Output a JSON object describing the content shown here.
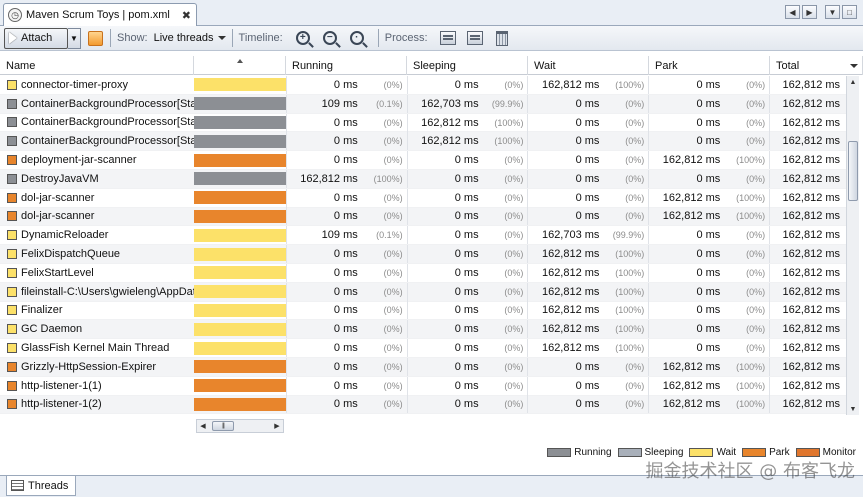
{
  "window": {
    "tab_title": "Maven Scrum Toys | pom.xml",
    "tab_close": "✖"
  },
  "toolbar": {
    "attach_label": "Attach",
    "show_label": "Show:",
    "show_value": "Live threads",
    "timeline_label": "Timeline:",
    "process_label": "Process:"
  },
  "columns": {
    "name": "Name",
    "running": "Running",
    "sleeping": "Sleeping",
    "wait": "Wait",
    "park": "Park",
    "total": "Total"
  },
  "state_colors": {
    "running": "#8c8f94",
    "sleeping": "#a9b0ba",
    "wait": "#fce169",
    "park": "#e8852c",
    "monitor": "#e0762d"
  },
  "rows": [
    {
      "name": "connector-timer-proxy",
      "state": "wait",
      "running": "0 ms",
      "running_pct": "(0%)",
      "sleeping": "0 ms",
      "sleeping_pct": "(0%)",
      "wait": "162,812 ms",
      "wait_pct": "(100%)",
      "park": "0 ms",
      "park_pct": "(0%)",
      "total": "162,812 ms"
    },
    {
      "name": "ContainerBackgroundProcessor[StandardEngine[com.sun.appserv]]",
      "state": "running",
      "running": "109 ms",
      "running_pct": "(0.1%)",
      "sleeping": "162,703 ms",
      "sleeping_pct": "(99.9%)",
      "wait": "0 ms",
      "wait_pct": "(0%)",
      "park": "0 ms",
      "park_pct": "(0%)",
      "total": "162,812 ms"
    },
    {
      "name": "ContainerBackgroundProcessor[StandardEngine[com.sun.appserv]]",
      "state": "running",
      "running": "0 ms",
      "running_pct": "(0%)",
      "sleeping": "162,812 ms",
      "sleeping_pct": "(100%)",
      "wait": "0 ms",
      "wait_pct": "(0%)",
      "park": "0 ms",
      "park_pct": "(0%)",
      "total": "162,812 ms"
    },
    {
      "name": "ContainerBackgroundProcessor[StandardEngine[com.sun.appserv]]",
      "state": "running",
      "running": "0 ms",
      "running_pct": "(0%)",
      "sleeping": "162,812 ms",
      "sleeping_pct": "(100%)",
      "wait": "0 ms",
      "wait_pct": "(0%)",
      "park": "0 ms",
      "park_pct": "(0%)",
      "total": "162,812 ms"
    },
    {
      "name": "deployment-jar-scanner",
      "state": "park",
      "running": "0 ms",
      "running_pct": "(0%)",
      "sleeping": "0 ms",
      "sleeping_pct": "(0%)",
      "wait": "0 ms",
      "wait_pct": "(0%)",
      "park": "162,812 ms",
      "park_pct": "(100%)",
      "total": "162,812 ms"
    },
    {
      "name": "DestroyJavaVM",
      "state": "running",
      "running": "162,812 ms",
      "running_pct": "(100%)",
      "sleeping": "0 ms",
      "sleeping_pct": "(0%)",
      "wait": "0 ms",
      "wait_pct": "(0%)",
      "park": "0 ms",
      "park_pct": "(0%)",
      "total": "162,812 ms"
    },
    {
      "name": "dol-jar-scanner",
      "state": "park",
      "running": "0 ms",
      "running_pct": "(0%)",
      "sleeping": "0 ms",
      "sleeping_pct": "(0%)",
      "wait": "0 ms",
      "wait_pct": "(0%)",
      "park": "162,812 ms",
      "park_pct": "(100%)",
      "total": "162,812 ms"
    },
    {
      "name": "dol-jar-scanner",
      "state": "park",
      "running": "0 ms",
      "running_pct": "(0%)",
      "sleeping": "0 ms",
      "sleeping_pct": "(0%)",
      "wait": "0 ms",
      "wait_pct": "(0%)",
      "park": "162,812 ms",
      "park_pct": "(100%)",
      "total": "162,812 ms"
    },
    {
      "name": "DynamicReloader",
      "state": "wait",
      "running": "109 ms",
      "running_pct": "(0.1%)",
      "sleeping": "0 ms",
      "sleeping_pct": "(0%)",
      "wait": "162,703 ms",
      "wait_pct": "(99.9%)",
      "park": "0 ms",
      "park_pct": "(0%)",
      "total": "162,812 ms"
    },
    {
      "name": "FelixDispatchQueue",
      "state": "wait",
      "running": "0 ms",
      "running_pct": "(0%)",
      "sleeping": "0 ms",
      "sleeping_pct": "(0%)",
      "wait": "162,812 ms",
      "wait_pct": "(100%)",
      "park": "0 ms",
      "park_pct": "(0%)",
      "total": "162,812 ms"
    },
    {
      "name": "FelixStartLevel",
      "state": "wait",
      "running": "0 ms",
      "running_pct": "(0%)",
      "sleeping": "0 ms",
      "sleeping_pct": "(0%)",
      "wait": "162,812 ms",
      "wait_pct": "(100%)",
      "park": "0 ms",
      "park_pct": "(0%)",
      "total": "162,812 ms"
    },
    {
      "name": "fileinstall-C:\\Users\\gwieleng\\AppData",
      "state": "wait",
      "running": "0 ms",
      "running_pct": "(0%)",
      "sleeping": "0 ms",
      "sleeping_pct": "(0%)",
      "wait": "162,812 ms",
      "wait_pct": "(100%)",
      "park": "0 ms",
      "park_pct": "(0%)",
      "total": "162,812 ms"
    },
    {
      "name": "Finalizer",
      "state": "wait",
      "running": "0 ms",
      "running_pct": "(0%)",
      "sleeping": "0 ms",
      "sleeping_pct": "(0%)",
      "wait": "162,812 ms",
      "wait_pct": "(100%)",
      "park": "0 ms",
      "park_pct": "(0%)",
      "total": "162,812 ms"
    },
    {
      "name": "GC Daemon",
      "state": "wait",
      "running": "0 ms",
      "running_pct": "(0%)",
      "sleeping": "0 ms",
      "sleeping_pct": "(0%)",
      "wait": "162,812 ms",
      "wait_pct": "(100%)",
      "park": "0 ms",
      "park_pct": "(0%)",
      "total": "162,812 ms"
    },
    {
      "name": "GlassFish Kernel Main Thread",
      "state": "wait",
      "running": "0 ms",
      "running_pct": "(0%)",
      "sleeping": "0 ms",
      "sleeping_pct": "(0%)",
      "wait": "162,812 ms",
      "wait_pct": "(100%)",
      "park": "0 ms",
      "park_pct": "(0%)",
      "total": "162,812 ms"
    },
    {
      "name": "Grizzly-HttpSession-Expirer",
      "state": "park",
      "running": "0 ms",
      "running_pct": "(0%)",
      "sleeping": "0 ms",
      "sleeping_pct": "(0%)",
      "wait": "0 ms",
      "wait_pct": "(0%)",
      "park": "162,812 ms",
      "park_pct": "(100%)",
      "total": "162,812 ms"
    },
    {
      "name": "http-listener-1(1)",
      "state": "park",
      "running": "0 ms",
      "running_pct": "(0%)",
      "sleeping": "0 ms",
      "sleeping_pct": "(0%)",
      "wait": "0 ms",
      "wait_pct": "(0%)",
      "park": "162,812 ms",
      "park_pct": "(100%)",
      "total": "162,812 ms"
    },
    {
      "name": "http-listener-1(2)",
      "state": "park",
      "running": "0 ms",
      "running_pct": "(0%)",
      "sleeping": "0 ms",
      "sleeping_pct": "(0%)",
      "wait": "0 ms",
      "wait_pct": "(0%)",
      "park": "162,812 ms",
      "park_pct": "(100%)",
      "total": "162,812 ms"
    }
  ],
  "legend": [
    {
      "key": "running",
      "label": "Running"
    },
    {
      "key": "sleeping",
      "label": "Sleeping"
    },
    {
      "key": "wait",
      "label": "Wait"
    },
    {
      "key": "park",
      "label": "Park"
    },
    {
      "key": "monitor",
      "label": "Monitor"
    }
  ],
  "bottom_tab": "Threads",
  "watermark": "掘金技术社区 @ 布客飞龙"
}
